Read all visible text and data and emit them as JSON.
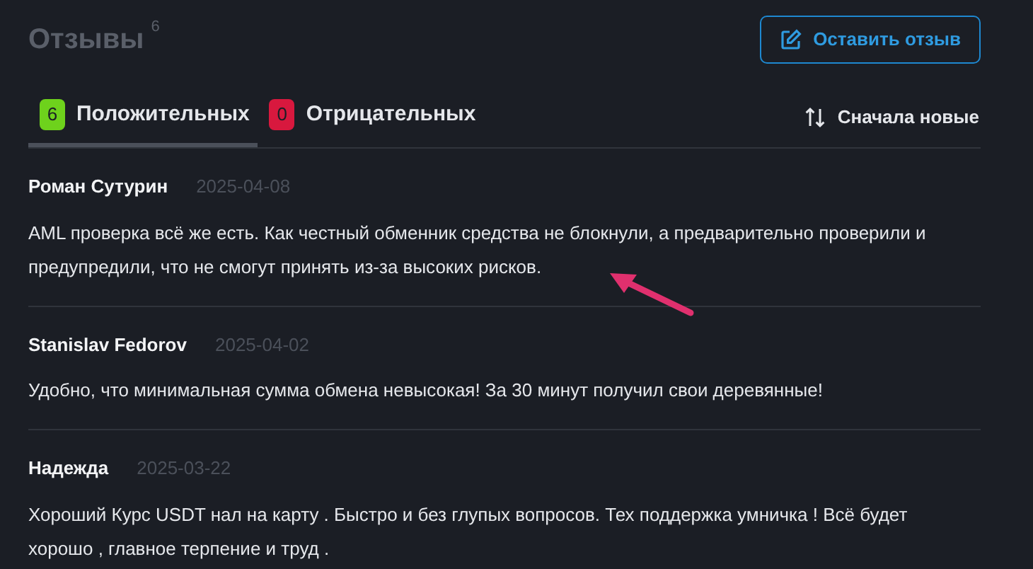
{
  "header": {
    "title": "Отзывы",
    "count": "6",
    "button": "Оставить отзыв"
  },
  "tabs": [
    {
      "count": "6",
      "label": "Положительных",
      "kind": "positive",
      "selected": true
    },
    {
      "count": "0",
      "label": "Отрицательных",
      "kind": "negative",
      "selected": false
    }
  ],
  "sort": {
    "label": "Сначала новые"
  },
  "reviews": [
    {
      "author": "Роман Сутурин",
      "date": "2025-04-08",
      "text": "AML проверка всё же есть. Как честный обменник средства не блокнули, а предварительно проверили и предупредили, что не смогут принять из-за высоких рисков."
    },
    {
      "author": "Stanislav Fedorov",
      "date": "2025-04-02",
      "text": "Удобно, что минимальная сумма обмена невысокая! За 30 минут получил свои деревянные!"
    },
    {
      "author": "Надежда",
      "date": "2025-03-22",
      "text": "Хороший Курс USDT нал на карту . Быстро и без глупых вопросов. Тех поддержка умничка ! Всё будет хорошо , главное терпение и труд ."
    }
  ]
}
